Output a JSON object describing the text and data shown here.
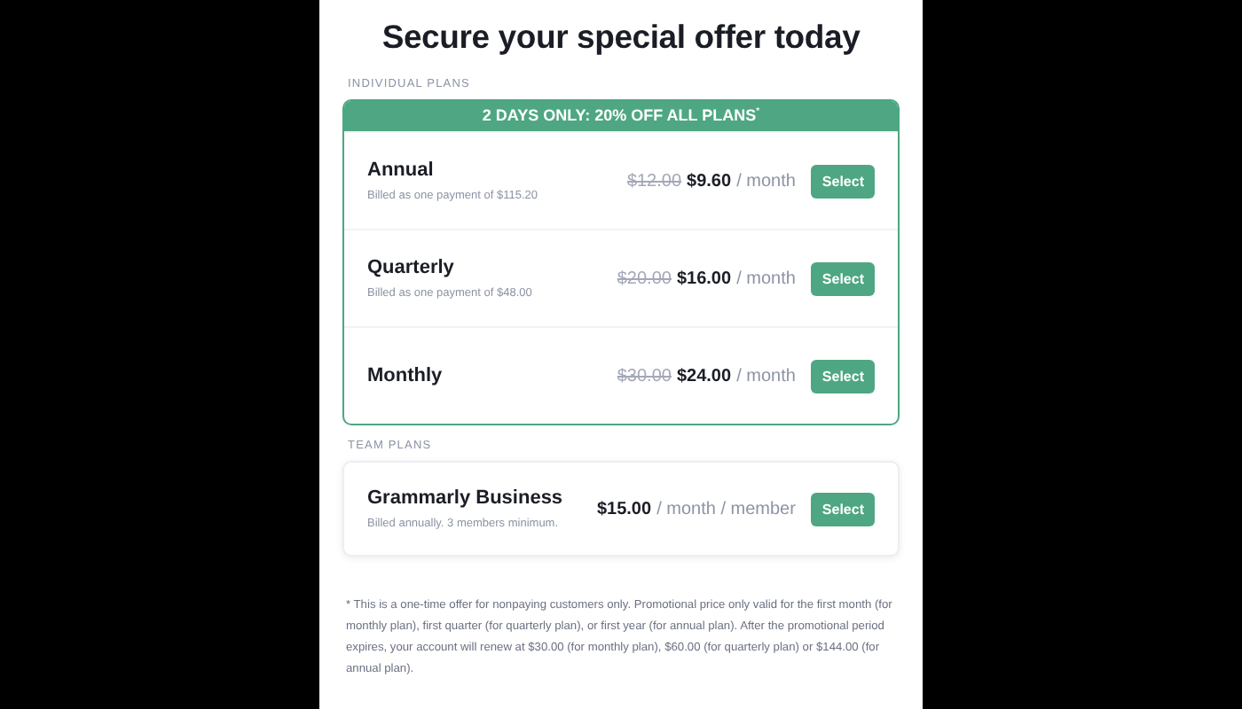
{
  "title": "Secure your special offer today",
  "individual": {
    "label": "INDIVIDUAL PLANS",
    "banner": "2 DAYS ONLY: 20% OFF ALL PLANS$^{*}$",
    "plans": [
      {
        "name": "Annual",
        "billing": "Billed as one payment of $115.20",
        "old_price": "$12.00",
        "price": "$9.60",
        "unit": "/ month",
        "button": "Select"
      },
      {
        "name": "Quarterly",
        "billing": "Billed as one payment of $48.00",
        "old_price": "$20.00",
        "price": "$16.00",
        "unit": "/ month",
        "button": "Select"
      },
      {
        "name": "Monthly",
        "old_price": "$30.00",
        "price": "$24.00",
        "unit": "/ month",
        "button": "Select"
      }
    ]
  },
  "team": {
    "label": "TEAM PLANS",
    "plans": [
      {
        "name": "Grammarly Business",
        "billing": "Billed annually. 3 members minimum.",
        "price": "$15.00",
        "unit": "/ month / member",
        "button": "Select"
      }
    ]
  },
  "footnote": "* This is a one-time offer for nonpaying customers only. Promotional price only valid for the first month (for monthly plan), first quarter (for quarterly plan), or first year (for annual plan). After the promotional period expires, your account will renew at $30.00 (for monthly plan), $60.00 (for quarterly plan) or $144.00 (for annual plan)."
}
